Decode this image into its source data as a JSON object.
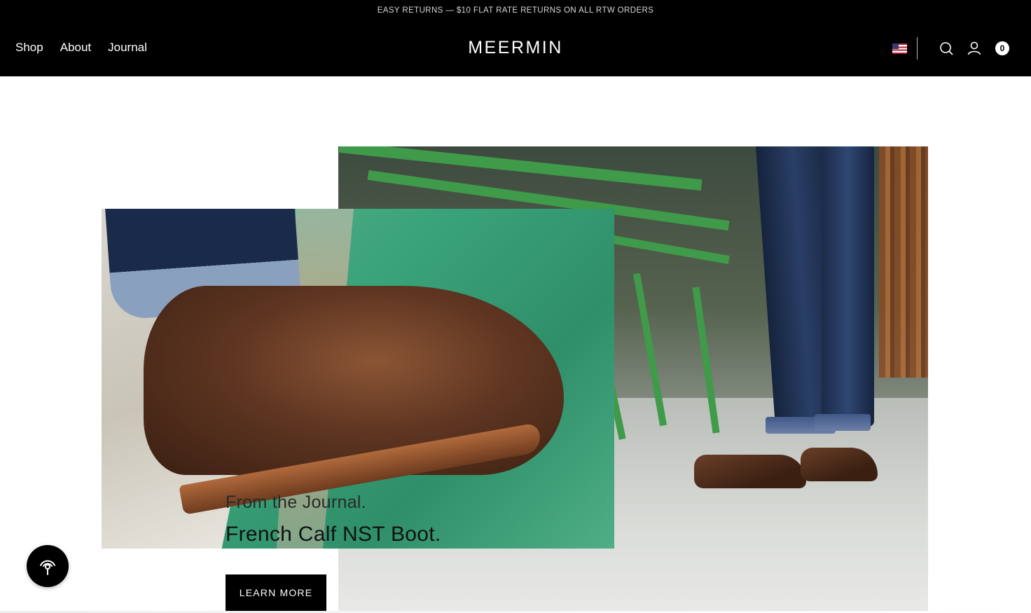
{
  "announcement": {
    "text": "EASY RETURNS — $10 FLAT RATE RETURNS ON ALL RTW ORDERS"
  },
  "header": {
    "nav": [
      {
        "label": "Shop"
      },
      {
        "label": "About"
      },
      {
        "label": "Journal"
      }
    ],
    "logo": "MEERMIN",
    "country_flag_icon": "us-flag-icon",
    "search_icon": "search-icon",
    "account_icon": "user-icon",
    "cart_count": "0"
  },
  "hero": {
    "eyebrow": "From the Journal.",
    "headline": "French Calf NST Boot.",
    "cta_label": "LEARN MORE"
  },
  "widget": {
    "icon": "accessibility-signal-icon"
  },
  "colors": {
    "header_bg": "#000000",
    "text_dark": "#111111",
    "button_bg": "#000000"
  }
}
